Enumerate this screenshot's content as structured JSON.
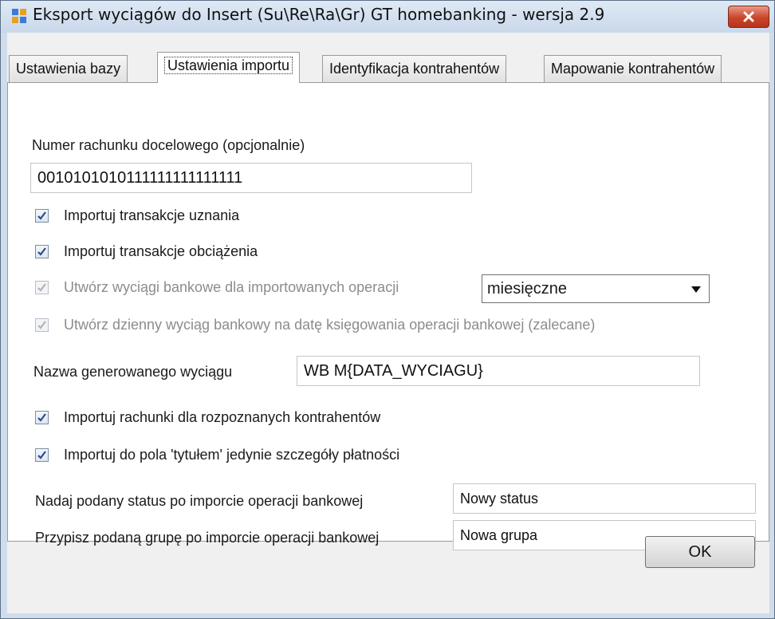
{
  "window": {
    "title": "Eksport wyciągów do Insert (Su\\Re\\Ra\\Gr) GT homebanking - wersja 2.9"
  },
  "tabs": [
    {
      "label": "Ustawienia bazy"
    },
    {
      "label": "Ustawienia importu"
    },
    {
      "label": "Identyfikacja kontrahentów"
    },
    {
      "label": "Mapowanie kontrahentów"
    }
  ],
  "import": {
    "account_label": "Numer rachunku docelowego (opcjonalnie)",
    "account_value": "0010101010111111111111111",
    "checkbox_credit": "Importuj transakcje uznania",
    "checkbox_debit": "Importuj transakcje obciążenia",
    "checkbox_statements": "Utwórz wyciągi bankowe dla importowanych operacji",
    "statement_period": "miesięczne",
    "checkbox_daily": "Utwórz dzienny wyciąg bankowy na datę księgowania operacji bankowej (zalecane)",
    "statement_name_label": "Nazwa generowanego wyciągu",
    "statement_name_value": "WB M{DATA_WYCIAGU}",
    "checkbox_invoices": "Importuj rachunki dla rozpoznanych kontrahentów",
    "checkbox_title": "Importuj do pola 'tytułem' jedynie szczegóły płatności",
    "status_label": "Nadaj podany status po imporcie operacji bankowej",
    "status_value": "Nowy status",
    "group_label": "Przypisz podaną grupę po imporcie operacji bankowej",
    "group_value": "Nowa grupa"
  },
  "buttons": {
    "ok": "OK"
  },
  "icons": [
    "app-icon",
    "close-icon",
    "checkmark-icon",
    "dropdown-arrow-icon"
  ],
  "colors": {
    "titlebar": "#c9d8ea",
    "close_button": "#c9452a",
    "checkmark": "#2a4c8c",
    "disabled_text": "#8c8c8c"
  }
}
